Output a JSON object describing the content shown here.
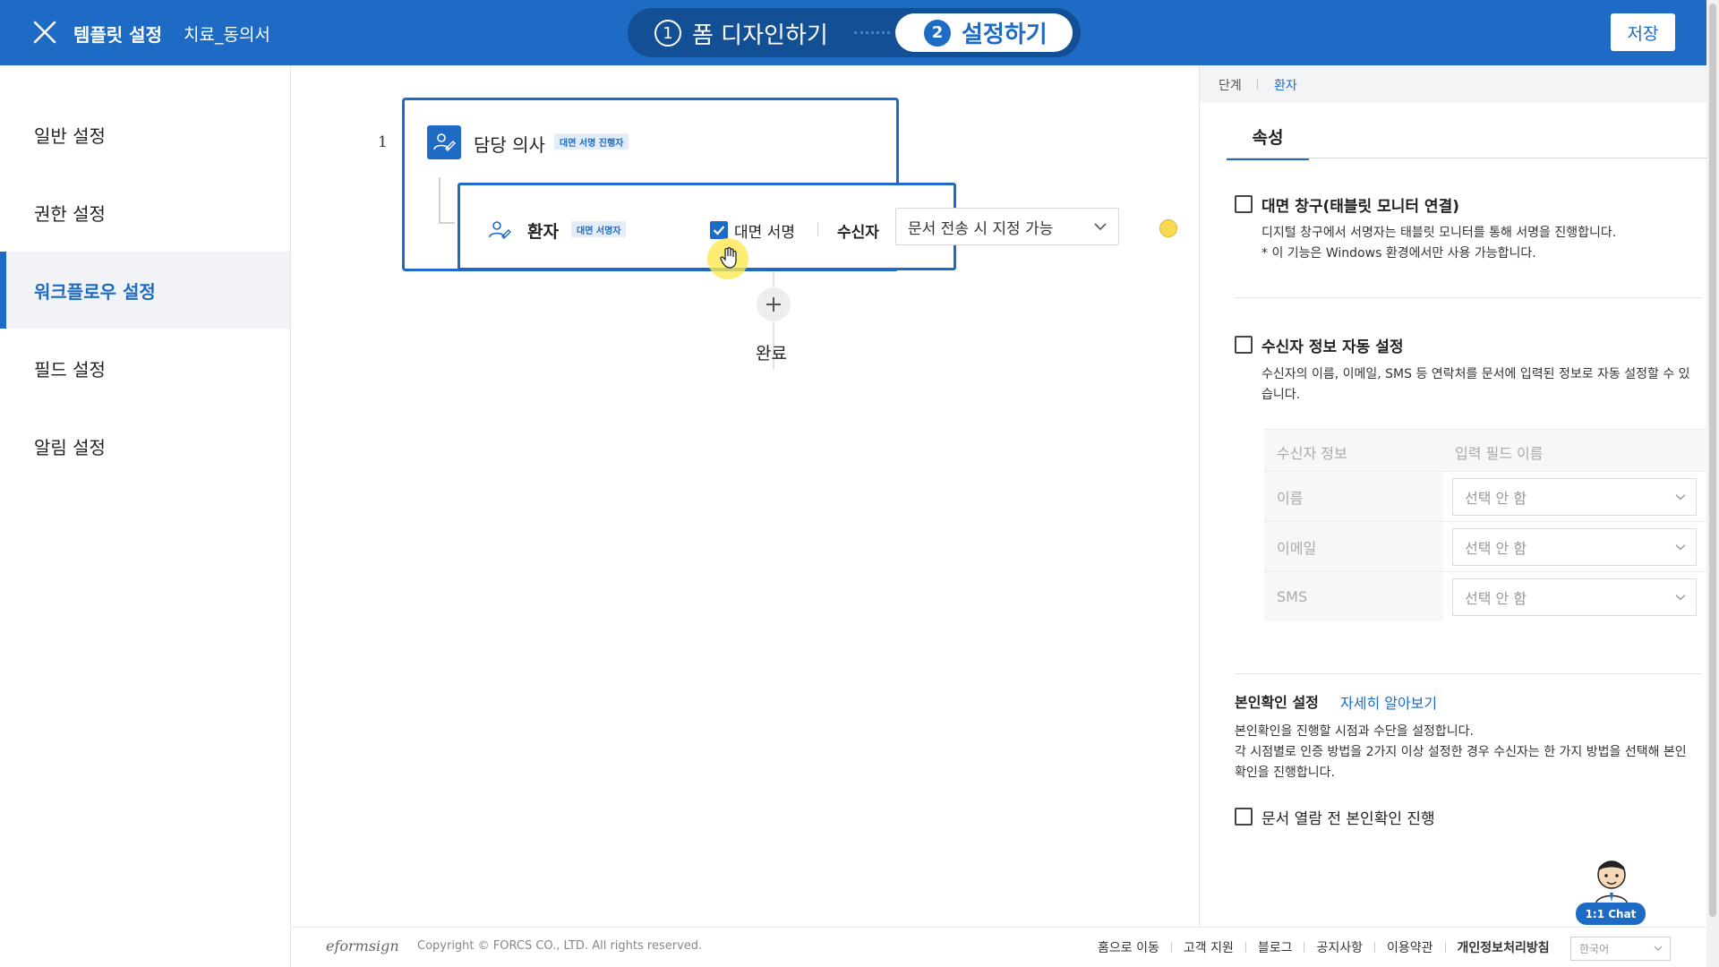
{
  "header": {
    "title": "템플릿 설정",
    "document_name": "치료_동의서",
    "steps": [
      {
        "number": "1",
        "label": "폼 디자인하기"
      },
      {
        "number": "2",
        "label": "설정하기"
      }
    ],
    "save_label": "저장",
    "accent_color": "#1d6bc4"
  },
  "sidebar": {
    "items": [
      {
        "label": "일반 설정"
      },
      {
        "label": "권한 설정"
      },
      {
        "label": "워크플로우 설정",
        "active": true
      },
      {
        "label": "필드 설정"
      },
      {
        "label": "알림 설정"
      }
    ]
  },
  "workflow": {
    "step_index": "1",
    "doctor": {
      "name": "담당 의사",
      "badge": "대면 서명 진행자"
    },
    "patient": {
      "name": "환자",
      "badge": "대면 서명자",
      "face_sign_label": "대면 서명",
      "face_sign_checked": true,
      "recipient_label": "수신자",
      "recipient_option": "문서 전송 시 지정 가능"
    },
    "complete_label": "완료"
  },
  "right_panel": {
    "breadcrumb": [
      "단계",
      "환자"
    ],
    "tab_label": "속성",
    "face_window": {
      "title": "대면 창구(태블릿 모니터 연결)",
      "desc1": "디지털 창구에서 서명자는 태블릿 모니터를 통해 서명을 진행합니다.",
      "desc2": "* 이 기능은 Windows 환경에서만 사용 가능합니다."
    },
    "auto_recipient": {
      "title": "수신자 정보 자동 설정",
      "desc1": "수신자의 이름, 이메일, SMS 등 연락처를 문서에 입력된 정보로 자동 설정할 수 있",
      "desc2": "습니다.",
      "table_headers": [
        "수신자 정보",
        "입력 필드 이름"
      ],
      "rows": [
        {
          "label": "이름",
          "value": "선택 안 함"
        },
        {
          "label": "이메일",
          "value": "선택 안 함"
        },
        {
          "label": "SMS",
          "value": "선택 안 함"
        }
      ]
    },
    "identity": {
      "title": "본인확인 설정",
      "learn_more": "자세히 알아보기",
      "desc1": "본인확인을 진행할 시점과 수단을 설정합니다.",
      "desc2": "각 시점별로 인증 방법을 2가지 이상 설정한 경우 수신자는 한 가지 방법을 선택해 본인",
      "desc3": "확인을 진행합니다.",
      "option_label": "문서 열람 전 본인확인 진행"
    }
  },
  "chat": {
    "label": "1:1 Chat"
  },
  "footer": {
    "logo": "eformsign",
    "copyright": "Copyright © FORCS CO., LTD. All rights reserved.",
    "links": [
      "홈으로 이동",
      "고객 지원",
      "블로그",
      "공지사항",
      "이용약관",
      "개인정보처리방침"
    ],
    "language": "한국어"
  }
}
